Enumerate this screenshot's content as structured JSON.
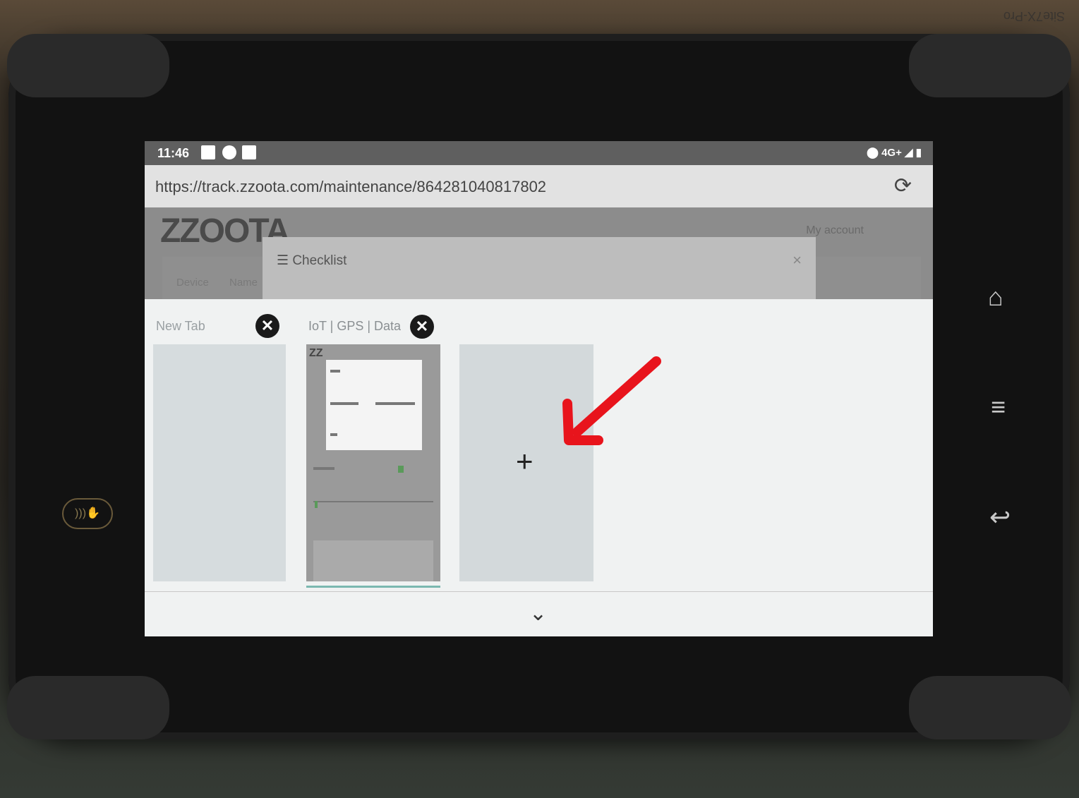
{
  "background": {
    "box_label": "Site7X-Pro"
  },
  "status_bar": {
    "time": "11:46",
    "network": "4G+"
  },
  "browser": {
    "url": "https://track.zzoota.com/maintenance/864281040817802",
    "reload_icon": "reload-icon"
  },
  "page": {
    "logo": "ZZOOTA",
    "account_link": "My account",
    "device_label": "Device",
    "name_label": "Name",
    "modal_title": "Checklist",
    "modal_close": "×"
  },
  "tab_switcher": {
    "tabs": [
      {
        "title": "New Tab",
        "close": "✕"
      },
      {
        "title": "IoT | GPS | Data",
        "close": "✕"
      }
    ],
    "new_tab_label": "+",
    "collapse_icon": "chevron-down-icon"
  },
  "system_nav": {
    "home": "⌂",
    "menu": "≡",
    "back": "↩"
  },
  "colors": {
    "annotation_arrow": "#e8141c"
  }
}
